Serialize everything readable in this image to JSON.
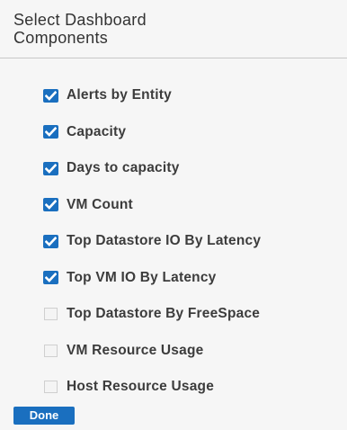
{
  "dialog": {
    "title_line1": "Select Dashboard",
    "title_line2": "Components",
    "done_label": "Done"
  },
  "colors": {
    "accent": "#1a6fbf",
    "background": "#f6f6f6",
    "text": "#3c3c3c"
  },
  "components": [
    {
      "label": "Alerts by Entity",
      "checked": true
    },
    {
      "label": "Capacity",
      "checked": true
    },
    {
      "label": "Days to capacity",
      "checked": true
    },
    {
      "label": "VM Count",
      "checked": true
    },
    {
      "label": "Top Datastore IO By Latency",
      "checked": true
    },
    {
      "label": "Top VM IO By Latency",
      "checked": true
    },
    {
      "label": "Top Datastore By FreeSpace",
      "checked": false
    },
    {
      "label": "VM Resource Usage",
      "checked": false
    },
    {
      "label": "Host Resource Usage",
      "checked": false
    }
  ]
}
